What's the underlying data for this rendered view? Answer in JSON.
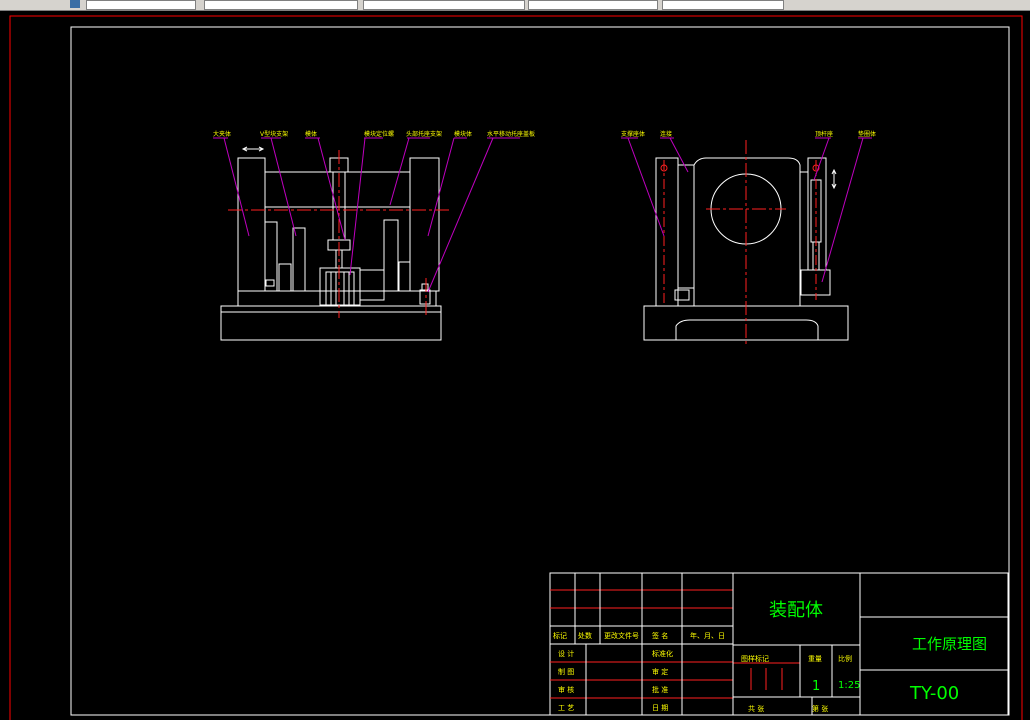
{
  "colors": {
    "background": "#000000",
    "drawing_lines": "#ffffff",
    "leader_lines": "#c000c0",
    "center_lines": "#ff2020",
    "annotation_text": "#ffff00",
    "title_text": "#00ff00",
    "frame_outer": "#ff0000"
  },
  "toolbar": {
    "icon": "app-icon"
  },
  "front_view": {
    "labels": [
      "大夹体",
      "V型块支架",
      "模体",
      "模块定位螺",
      "头部托座支架",
      "模块体",
      "水平移动托座盖板"
    ]
  },
  "side_view": {
    "labels": [
      "支撑座体",
      "连接",
      "顶杆座",
      "垫圈体"
    ]
  },
  "title_block": {
    "rev_headers": [
      "标记",
      "处数",
      "更改文件号",
      "签 名",
      "年、月、日"
    ],
    "rows": [
      "设 计",
      "制 图",
      "审 核",
      "工 艺"
    ],
    "mid_rows": [
      "标准化",
      "审 定",
      "批 准",
      "日 期"
    ],
    "drawing_name": "装配体",
    "stage_label": "图样标记",
    "weight_label": "重量",
    "scale_label": "比例",
    "quantity": "1",
    "scale": "1:25",
    "sheet_total_label": "共 张",
    "sheet_label": "第 张",
    "title_right": "工作原理图",
    "drawing_code": "TY-00"
  }
}
